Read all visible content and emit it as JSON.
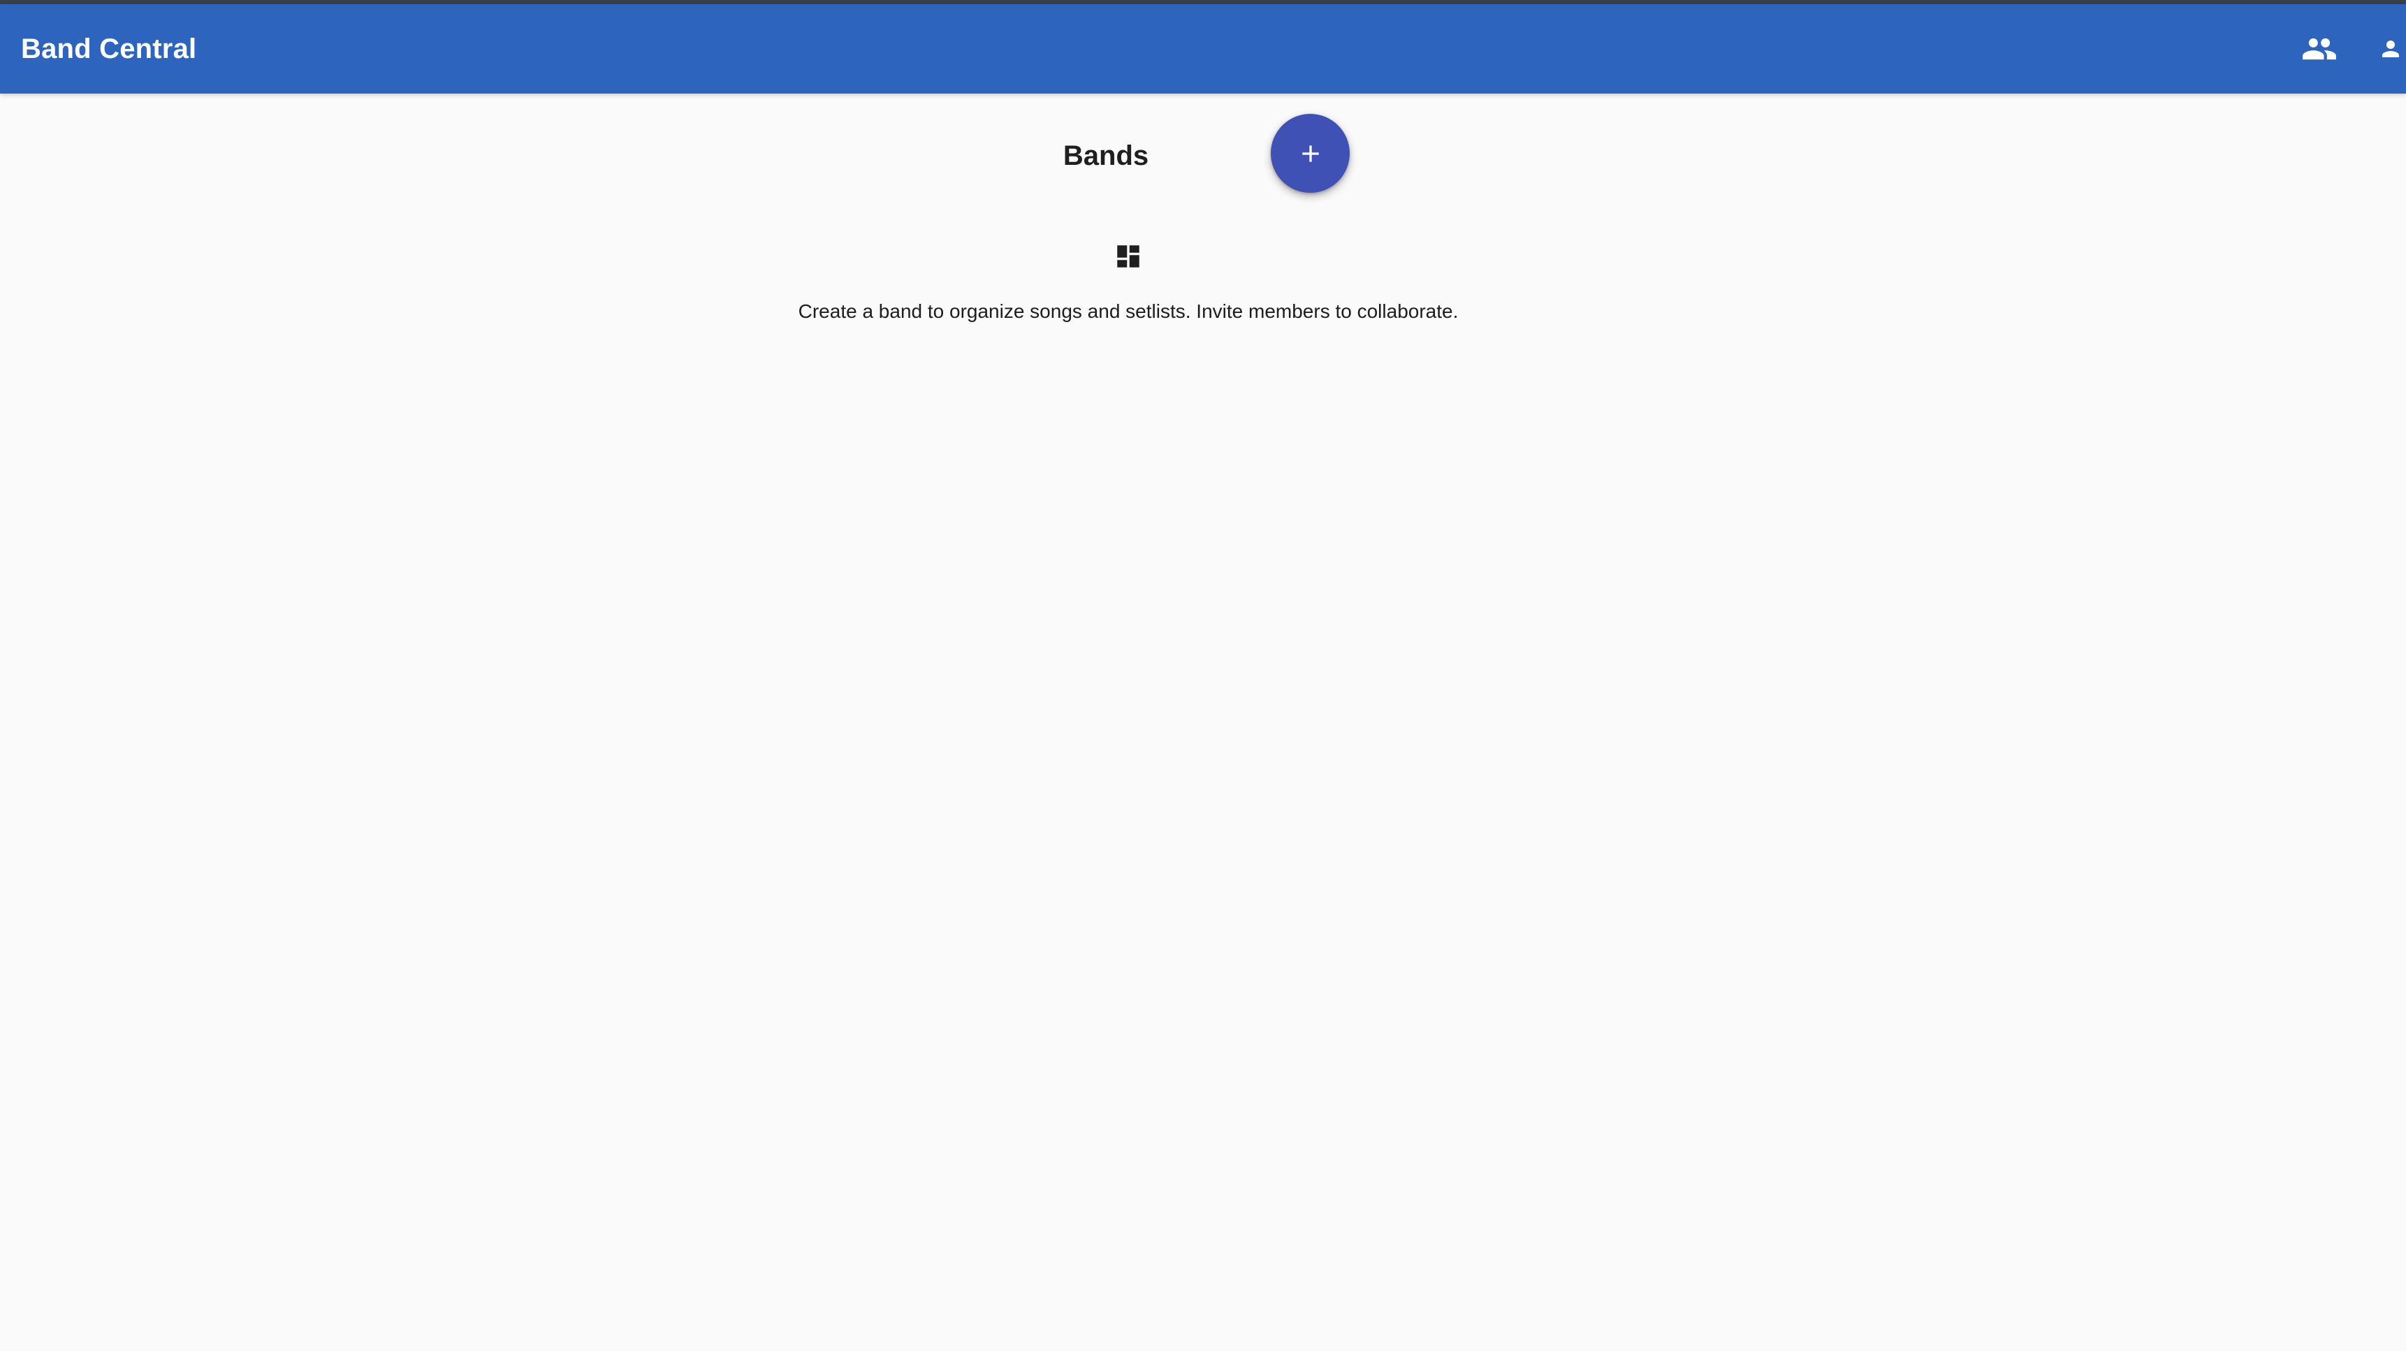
{
  "app_bar": {
    "title": "Band Central",
    "background_color": "#2d64bd",
    "actions": [
      {
        "icon": "groups-icon"
      },
      {
        "icon": "account-icon"
      }
    ]
  },
  "main": {
    "title": "Bands",
    "add_button": {
      "icon": "plus-icon",
      "color": "#3f51b5"
    },
    "empty_state": {
      "icon": "dashboard-icon",
      "message": "Create a band to organize songs and setlists. Invite members to collaborate."
    }
  }
}
